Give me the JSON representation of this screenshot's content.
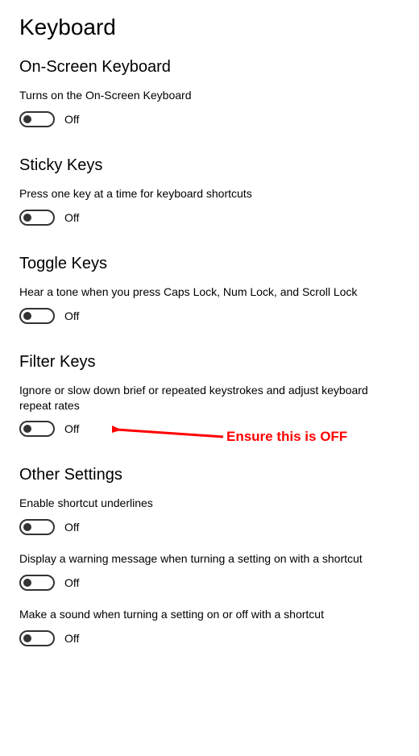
{
  "page_title": "Keyboard",
  "sections": {
    "osk": {
      "heading": "On-Screen Keyboard",
      "desc": "Turns on the On-Screen Keyboard",
      "state": "Off",
      "on": false
    },
    "sticky": {
      "heading": "Sticky Keys",
      "desc": "Press one key at a time for keyboard shortcuts",
      "state": "Off",
      "on": false
    },
    "toggle": {
      "heading": "Toggle Keys",
      "desc": "Hear a tone when you press Caps Lock, Num Lock, and Scroll Lock",
      "state": "Off",
      "on": false
    },
    "filter": {
      "heading": "Filter Keys",
      "desc": "Ignore or slow down brief or repeated keystrokes and adjust keyboard repeat rates",
      "state": "Off",
      "on": false
    },
    "other": {
      "heading": "Other Settings",
      "items": [
        {
          "desc": "Enable shortcut underlines",
          "state": "Off",
          "on": false
        },
        {
          "desc": "Display a warning message when turning a setting on with a shortcut",
          "state": "Off",
          "on": false
        },
        {
          "desc": "Make a sound when turning a setting on or off with a shortcut",
          "state": "Off",
          "on": false
        }
      ]
    }
  },
  "annotation": {
    "text": "Ensure this is OFF",
    "color": "#ff0000",
    "target": "filter-keys-toggle"
  }
}
